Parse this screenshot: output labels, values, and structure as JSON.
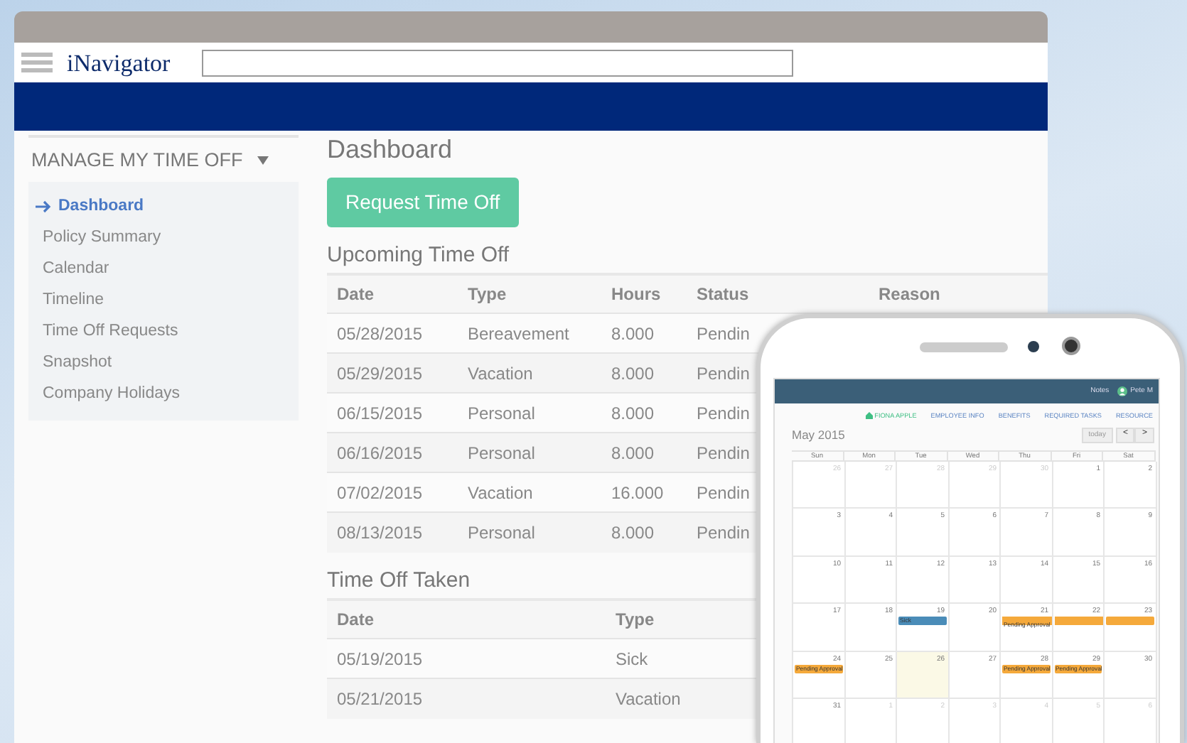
{
  "app": {
    "logo": "iNavigator"
  },
  "sidebar": {
    "title": "MANAGE MY TIME OFF",
    "items": [
      {
        "label": "Dashboard",
        "selected": true
      },
      {
        "label": "Policy Summary",
        "selected": false
      },
      {
        "label": "Calendar",
        "selected": false
      },
      {
        "label": "Timeline",
        "selected": false
      },
      {
        "label": "Time Off Requests",
        "selected": false
      },
      {
        "label": "Snapshot",
        "selected": false
      },
      {
        "label": "Company Holidays",
        "selected": false
      }
    ]
  },
  "main": {
    "title": "Dashboard",
    "action_button": "Request Time Off",
    "upcoming": {
      "title": "Upcoming Time Off",
      "columns": [
        "Date",
        "Type",
        "Hours",
        "Status",
        "Reason"
      ],
      "rows": [
        [
          "05/28/2015",
          "Bereavement",
          "8.000",
          "Pendin"
        ],
        [
          "05/29/2015",
          "Vacation",
          "8.000",
          "Pendin"
        ],
        [
          "06/15/2015",
          "Personal",
          "8.000",
          "Pendin"
        ],
        [
          "06/16/2015",
          "Personal",
          "8.000",
          "Pendin"
        ],
        [
          "07/02/2015",
          "Vacation",
          "16.000",
          "Pendin"
        ],
        [
          "08/13/2015",
          "Personal",
          "8.000",
          "Pendin"
        ]
      ]
    },
    "taken": {
      "title": "Time Off Taken",
      "columns": [
        "Date",
        "Type"
      ],
      "rows": [
        [
          "05/19/2015",
          "Sick"
        ],
        [
          "05/21/2015",
          "Vacation"
        ]
      ]
    }
  },
  "phone": {
    "header": {
      "notes": "Notes",
      "user": "Pete M"
    },
    "nav": [
      {
        "label": "FIONA APPLE",
        "selected": true
      },
      {
        "label": "EMPLOYEE INFO",
        "selected": false
      },
      {
        "label": "BENEFITS",
        "selected": false
      },
      {
        "label": "REQUIRED TASKS",
        "selected": false
      },
      {
        "label": "RESOURCE",
        "selected": false
      }
    ],
    "calendar": {
      "title": "May 2015",
      "today_button": "today",
      "prev": "<",
      "next": ">",
      "weekdays": [
        "Sun",
        "Mon",
        "Tue",
        "Wed",
        "Thu",
        "Fri",
        "Sat"
      ],
      "weeks": [
        [
          {
            "day": "26",
            "other_month": true
          },
          {
            "day": "27",
            "other_month": true
          },
          {
            "day": "28",
            "other_month": true
          },
          {
            "day": "29",
            "other_month": true
          },
          {
            "day": "30",
            "other_month": true
          },
          {
            "day": "1",
            "other_month": false
          },
          {
            "day": "2",
            "other_month": false
          }
        ],
        [
          {
            "day": "3",
            "other_month": false
          },
          {
            "day": "4",
            "other_month": false
          },
          {
            "day": "5",
            "other_month": false
          },
          {
            "day": "6",
            "other_month": false
          },
          {
            "day": "7",
            "other_month": false
          },
          {
            "day": "8",
            "other_month": false
          },
          {
            "day": "9",
            "other_month": false
          }
        ],
        [
          {
            "day": "10",
            "other_month": false
          },
          {
            "day": "11",
            "other_month": false
          },
          {
            "day": "12",
            "other_month": false
          },
          {
            "day": "13",
            "other_month": false
          },
          {
            "day": "14",
            "other_month": false
          },
          {
            "day": "15",
            "other_month": false
          },
          {
            "day": "16",
            "other_month": false
          }
        ],
        [
          {
            "day": "17",
            "other_month": false
          },
          {
            "day": "18",
            "other_month": false
          },
          {
            "day": "19",
            "other_month": false,
            "events": [
              {
                "label": "Sick",
                "color": "#4a8cb8",
                "continues": false
              }
            ]
          },
          {
            "day": "20",
            "other_month": false
          },
          {
            "day": "21",
            "other_month": false,
            "events": [
              {
                "label": "Pending Approval",
                "color": "#f5a93b",
                "continues": true
              }
            ]
          },
          {
            "day": "22",
            "other_month": false,
            "events": [
              {
                "color": "#f5a93b",
                "continues": true
              }
            ]
          },
          {
            "day": "23",
            "other_month": false,
            "events": [
              {
                "color": "#f5a93b",
                "continues": false
              }
            ]
          }
        ],
        [
          {
            "day": "24",
            "other_month": false,
            "events": [
              {
                "label": "Pending Approval",
                "color": "#f5a93b",
                "continues": false
              }
            ]
          },
          {
            "day": "25",
            "other_month": false
          },
          {
            "day": "26",
            "other_month": false,
            "today": true
          },
          {
            "day": "27",
            "other_month": false
          },
          {
            "day": "28",
            "other_month": false,
            "events": [
              {
                "label": "Pending Approval",
                "color": "#f5a93b",
                "continues": false
              }
            ]
          },
          {
            "day": "29",
            "other_month": false,
            "events": [
              {
                "label": "Pending Approval",
                "color": "#f5a93b",
                "continues": false
              }
            ]
          },
          {
            "day": "30",
            "other_month": false
          }
        ],
        [
          {
            "day": "31",
            "other_month": false
          },
          {
            "day": "1",
            "other_month": true
          },
          {
            "day": "2",
            "other_month": true
          },
          {
            "day": "3",
            "other_month": true
          },
          {
            "day": "4",
            "other_month": true
          },
          {
            "day": "5",
            "other_month": true
          },
          {
            "day": "6",
            "other_month": true
          }
        ]
      ]
    }
  }
}
